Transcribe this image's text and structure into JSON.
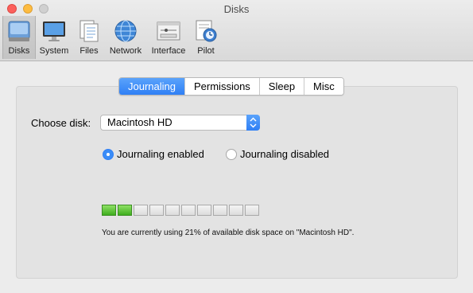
{
  "window": {
    "title": "Disks"
  },
  "toolbar": {
    "items": [
      {
        "label": "Disks",
        "icon": "disk-icon"
      },
      {
        "label": "System",
        "icon": "display-icon"
      },
      {
        "label": "Files",
        "icon": "files-icon"
      },
      {
        "label": "Network",
        "icon": "globe-icon"
      },
      {
        "label": "Interface",
        "icon": "interface-icon"
      },
      {
        "label": "Pilot",
        "icon": "pilot-icon"
      }
    ],
    "selected": "Disks"
  },
  "tabs": [
    "Journaling",
    "Permissions",
    "Sleep",
    "Misc"
  ],
  "active_tab": "Journaling",
  "disk_select": {
    "label": "Choose disk:",
    "value": "Macintosh HD"
  },
  "journaling": {
    "options": [
      "Journaling enabled",
      "Journaling disabled"
    ],
    "selected": "Journaling enabled"
  },
  "usage": {
    "percent": 21,
    "segments_total": 10,
    "segments_filled": 2,
    "text": "You are currently using 21% of available disk space on \"Macintosh HD\"."
  },
  "colors": {
    "accent": "#2f7ff5",
    "meter_fill": "#3fae1e",
    "close": "#fc605c",
    "minimize": "#fdbc40"
  }
}
